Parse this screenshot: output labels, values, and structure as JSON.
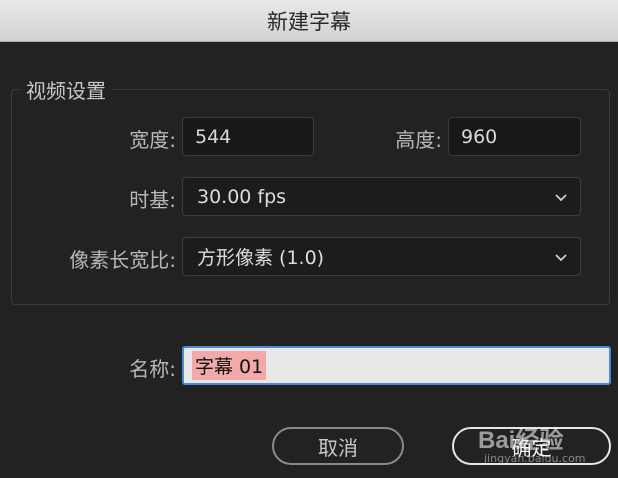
{
  "window": {
    "title": "新建字幕"
  },
  "video_settings": {
    "group_label": "视频设置",
    "width": {
      "label": "宽度:",
      "value": "544"
    },
    "height": {
      "label": "高度:",
      "value": "960"
    },
    "timebase": {
      "label": "时基:",
      "value": "30.00 fps"
    },
    "pixel_aspect": {
      "label": "像素长宽比:",
      "value": "方形像素 (1.0)"
    }
  },
  "name": {
    "label": "名称:",
    "value": "字幕 01"
  },
  "buttons": {
    "cancel": "取消",
    "ok": "确定"
  },
  "watermark": {
    "text": "Bai经验",
    "sub": "jingyan.baidu.com"
  },
  "colors": {
    "background": "#222222",
    "focus_border": "#4a8ad6",
    "selection": "#f2a9a9"
  }
}
